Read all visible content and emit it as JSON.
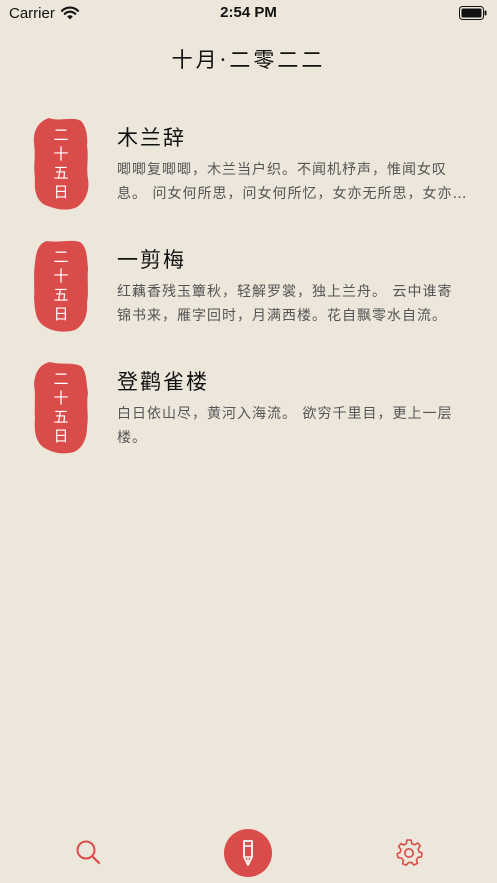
{
  "status_bar": {
    "carrier": "Carrier",
    "time": "2:54 PM",
    "wifi_icon": "wifi-icon",
    "battery_icon": "battery-icon"
  },
  "header": {
    "title": "十月·二零二二"
  },
  "entries": [
    {
      "date_chars": [
        "二",
        "十",
        "五",
        "日"
      ],
      "title": "木兰辞",
      "excerpt": "唧唧复唧唧，木兰当户织。不闻机杼声，惟闻女叹息。 问女何所思，问女何所忆，女亦无所思，女亦无所忆。"
    },
    {
      "date_chars": [
        "二",
        "十",
        "五",
        "日"
      ],
      "title": "一剪梅",
      "excerpt": "红藕香残玉簟秋，轻解罗裳，独上兰舟。 云中谁寄锦书来，雁字回时，月满西楼。花自飘零水自流。"
    },
    {
      "date_chars": [
        "二",
        "十",
        "五",
        "日"
      ],
      "title": "登鹳雀楼",
      "excerpt": "白日依山尽，黄河入海流。 欲穷千里目，更上一层楼。"
    }
  ],
  "tab_bar": {
    "search_icon": "search-icon",
    "compose_icon": "pen-icon",
    "settings_icon": "gear-icon"
  },
  "colors": {
    "background": "#ece6db",
    "accent": "#d94c4a",
    "text": "#1f1f1f",
    "muted": "#555555"
  }
}
